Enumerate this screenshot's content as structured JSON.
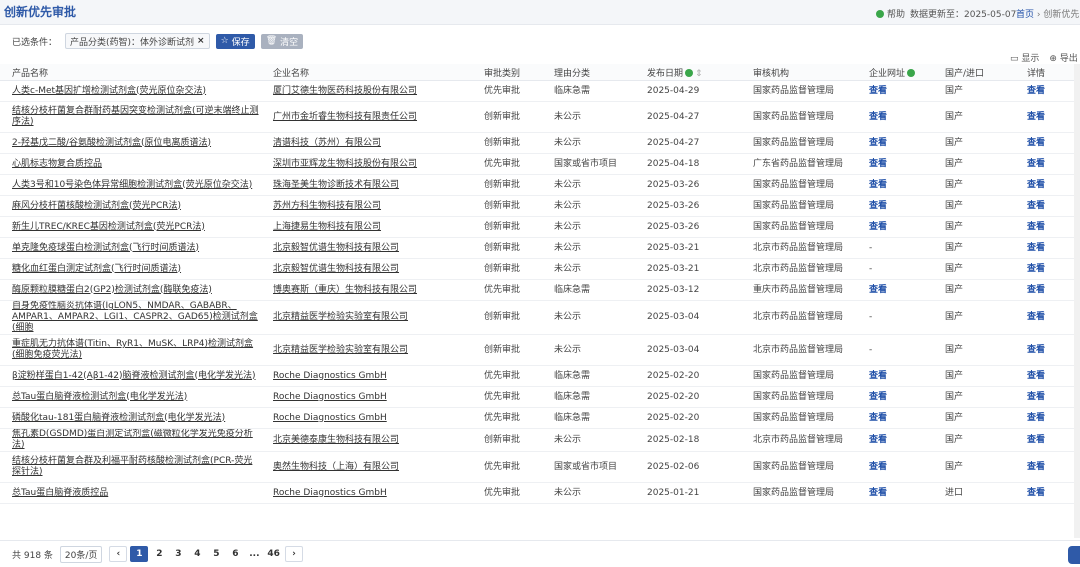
{
  "header": {
    "title": "创新优先审批",
    "help": "帮助",
    "updated": "数据更新至：2025-05-07",
    "breadcrumb_home": "首页",
    "breadcrumb_sep": "›",
    "breadcrumb_current": "创新优先审"
  },
  "filters": {
    "label": "已选条件：",
    "tag": "产品分类(药智)：体外诊断试剂",
    "tag_close": "×",
    "save": "保存",
    "clear": "清空"
  },
  "toolbar": {
    "show": "显示",
    "export": "导出"
  },
  "table": {
    "columns": [
      "产品名称",
      "企业名称",
      "审批类别",
      "理由分类",
      "发布日期",
      "审核机构",
      "企业网址",
      "国产/进口",
      "详情"
    ],
    "rows": [
      {
        "p": "人类c-Met基因扩增检测试剂盒(荧光原位杂交法)",
        "c": "厦门艾德生物医药科技股份有限公司",
        "t": "优先审批",
        "r": "临床急需",
        "d": "2025-04-29",
        "o": "国家药品监督管理局",
        "w": "查看",
        "i": "国产",
        "v": "查看"
      },
      {
        "p": "结核分枝杆菌复合群耐药基因突变检测试剂盒(可逆末端终止测序法)",
        "c": "广州市金圻睿生物科技有限责任公司",
        "t": "创新审批",
        "r": "未公示",
        "d": "2025-04-27",
        "o": "国家药品监督管理局",
        "w": "查看",
        "i": "国产",
        "v": "查看"
      },
      {
        "p": "2-羟基戊二酸/谷氨酸检测试剂盒(原位电离质谱法)",
        "c": "清谱科技（苏州）有限公司",
        "t": "创新审批",
        "r": "未公示",
        "d": "2025-04-27",
        "o": "国家药品监督管理局",
        "w": "查看",
        "i": "国产",
        "v": "查看"
      },
      {
        "p": "心肌标志物复合质控品",
        "c": "深圳市亚辉龙生物科技股份有限公司",
        "t": "优先审批",
        "r": "国家或省市项目",
        "d": "2025-04-18",
        "o": "广东省药品监督管理局",
        "w": "查看",
        "i": "国产",
        "v": "查看"
      },
      {
        "p": "人类3号和10号染色体异常细胞检测试剂盒(荧光原位杂交法)",
        "c": "珠海圣美生物诊断技术有限公司",
        "t": "创新审批",
        "r": "未公示",
        "d": "2025-03-26",
        "o": "国家药品监督管理局",
        "w": "查看",
        "i": "国产",
        "v": "查看"
      },
      {
        "p": "麻风分枝杆菌核酸检测试剂盒(荧光PCR法)",
        "c": "苏州方科生物科技有限公司",
        "t": "创新审批",
        "r": "未公示",
        "d": "2025-03-26",
        "o": "国家药品监督管理局",
        "w": "查看",
        "i": "国产",
        "v": "查看"
      },
      {
        "p": "新生儿TREC/KREC基因检测试剂盒(荧光PCR法)",
        "c": "上海捷易生物科技有限公司",
        "t": "创新审批",
        "r": "未公示",
        "d": "2025-03-26",
        "o": "国家药品监督管理局",
        "w": "查看",
        "i": "国产",
        "v": "查看"
      },
      {
        "p": "单克隆免疫球蛋白检测试剂盒(飞行时间质谱法)",
        "c": "北京毅智优谱生物科技有限公司",
        "t": "创新审批",
        "r": "未公示",
        "d": "2025-03-21",
        "o": "北京市药品监督管理局",
        "w": "-",
        "i": "国产",
        "v": "查看"
      },
      {
        "p": "糖化血红蛋白测定试剂盒(飞行时间质谱法)",
        "c": "北京毅智优谱生物科技有限公司",
        "t": "创新审批",
        "r": "未公示",
        "d": "2025-03-21",
        "o": "北京市药品监督管理局",
        "w": "-",
        "i": "国产",
        "v": "查看"
      },
      {
        "p": "酶原颗粒膜糖蛋白2(GP2)检测试剂盒(酶联免疫法)",
        "c": "博奥赛斯（重庆）生物科技有限公司",
        "t": "优先审批",
        "r": "临床急需",
        "d": "2025-03-12",
        "o": "重庆市药品监督管理局",
        "w": "查看",
        "i": "国产",
        "v": "查看"
      },
      {
        "p": "自身免疫性脑炎抗体谱(IgLON5、NMDAR、GABABR、AMPAR1、AMPAR2、LGI1、CASPR2、GAD65)检测试剂盒(细胞",
        "c": "北京精益医学检验实验室有限公司",
        "t": "创新审批",
        "r": "未公示",
        "d": "2025-03-04",
        "o": "北京市药品监督管理局",
        "w": "-",
        "i": "国产",
        "v": "查看"
      },
      {
        "p": "重症肌无力抗体谱(Titin、RyR1、MuSK、LRP4)检测试剂盒(细胞免疫荧光法)",
        "c": "北京精益医学检验实验室有限公司",
        "t": "创新审批",
        "r": "未公示",
        "d": "2025-03-04",
        "o": "北京市药品监督管理局",
        "w": "-",
        "i": "国产",
        "v": "查看"
      },
      {
        "p": "β淀粉样蛋白1-42(Aβ1-42)脑脊液检测试剂盒(电化学发光法)",
        "c": "Roche Diagnostics GmbH",
        "t": "优先审批",
        "r": "临床急需",
        "d": "2025-02-20",
        "o": "国家药品监督管理局",
        "w": "查看",
        "i": "国产",
        "v": "查看"
      },
      {
        "p": "总Tau蛋白脑脊液检测试剂盒(电化学发光法)",
        "c": "Roche Diagnostics GmbH",
        "t": "优先审批",
        "r": "临床急需",
        "d": "2025-02-20",
        "o": "国家药品监督管理局",
        "w": "查看",
        "i": "国产",
        "v": "查看"
      },
      {
        "p": "磷酸化tau-181蛋白脑脊液检测试剂盒(电化学发光法)",
        "c": "Roche Diagnostics GmbH",
        "t": "优先审批",
        "r": "临床急需",
        "d": "2025-02-20",
        "o": "国家药品监督管理局",
        "w": "查看",
        "i": "国产",
        "v": "查看"
      },
      {
        "p": "焦孔素D(GSDMD)蛋白测定试剂盒(磁微粒化学发光免疫分析法)",
        "c": "北京美德泰康生物科技有限公司",
        "t": "创新审批",
        "r": "未公示",
        "d": "2025-02-18",
        "o": "北京市药品监督管理局",
        "w": "查看",
        "i": "国产",
        "v": "查看"
      },
      {
        "p": "结核分枝杆菌复合群及利福平耐药核酸检测试剂盒(PCR-荧光探针法)",
        "c": "奥然生物科技（上海）有限公司",
        "t": "优先审批",
        "r": "国家或省市项目",
        "d": "2025-02-06",
        "o": "国家药品监督管理局",
        "w": "查看",
        "i": "国产",
        "v": "查看"
      },
      {
        "p": "总Tau蛋白脑脊液质控品",
        "c": "Roche Diagnostics GmbH",
        "t": "优先审批",
        "r": "未公示",
        "d": "2025-01-21",
        "o": "国家药品监督管理局",
        "w": "查看",
        "i": "进口",
        "v": "查看"
      }
    ]
  },
  "footer": {
    "total": "共 918 条",
    "pagesize": "20条/页",
    "prev": "‹",
    "next": "›",
    "pages": [
      "1",
      "2",
      "3",
      "4",
      "5",
      "6",
      "...",
      "46"
    ]
  }
}
